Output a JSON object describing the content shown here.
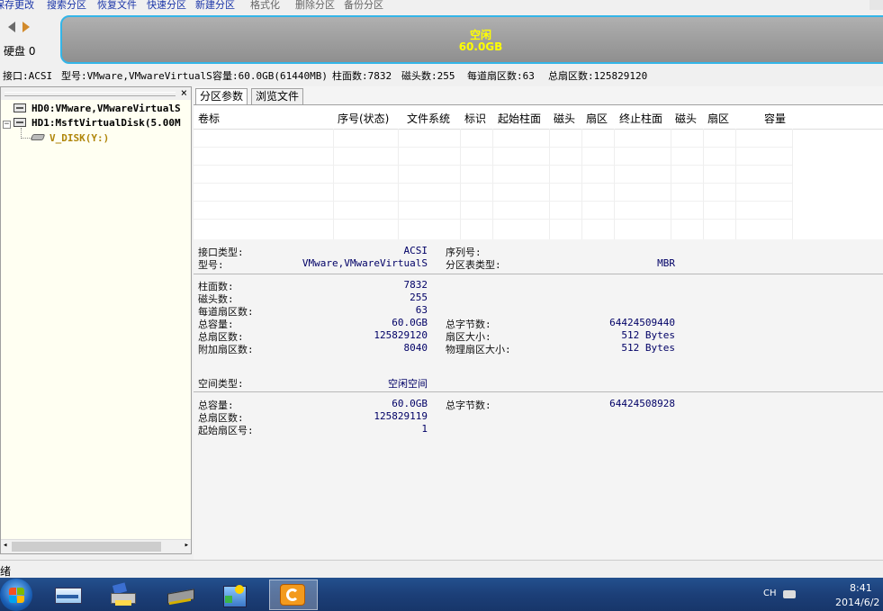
{
  "toolbar": {
    "items": [
      "保存更改",
      "搜索分区",
      "恢复文件",
      "快速分区",
      "新建分区",
      "格式化",
      "删除分区",
      "备份分区"
    ]
  },
  "diskbar": {
    "disk_label": "硬盘 0",
    "partition_label": "空闲",
    "partition_size": "60.0GB"
  },
  "infoline": {
    "interface": "接口:ACSI",
    "model": "型号:VMware,VMwareVirtualS",
    "capacity": "容量:60.0GB(61440MB)",
    "cylinders": "柱面数:7832",
    "heads": "磁头数:255",
    "sectors_per_track": "每道扇区数:63",
    "total_sectors": "总扇区数:125829120"
  },
  "tree": {
    "close": "×",
    "items": [
      {
        "label": "HD0:VMware,VMwareVirtualS"
      },
      {
        "label": "HD1:MsftVirtualDisk(5.00M"
      },
      {
        "label": "V_DISK(Y:)"
      }
    ]
  },
  "tabs": [
    "分区参数",
    "浏览文件"
  ],
  "table": {
    "columns": [
      "卷标",
      "序号(状态)",
      "文件系统",
      "标识",
      "起始柱面",
      "磁头",
      "扇区",
      "终止柱面",
      "磁头",
      "扇区",
      "容量"
    ]
  },
  "details": {
    "section1": {
      "interface_type_label": "接口类型:",
      "interface_type_value": "ACSI",
      "serial_label": "序列号:",
      "model_label": "型号:",
      "model_value": "VMware,VMwareVirtualS",
      "pt_type_label": "分区表类型:",
      "pt_type_value": "MBR"
    },
    "section2": {
      "cylinders_label": "柱面数:",
      "cylinders_value": "7832",
      "heads_label": "磁头数:",
      "heads_value": "255",
      "spt_label": "每道扇区数:",
      "spt_value": "63",
      "total_cap_label": "总容量:",
      "total_cap_value": "60.0GB",
      "total_bytes_label": "总字节数:",
      "total_bytes_value": "64424509440",
      "total_sectors_label": "总扇区数:",
      "total_sectors_value": "125829120",
      "sector_size_label": "扇区大小:",
      "sector_size_value": "512 Bytes",
      "extra_sectors_label": "附加扇区数:",
      "extra_sectors_value": "8040",
      "phys_sector_label": "物理扇区大小:",
      "phys_sector_value": "512 Bytes"
    },
    "section3": {
      "space_type_label": "空间类型:",
      "space_type_value": "空闲空间"
    },
    "section4": {
      "total_cap_label": "总容量:",
      "total_cap_value": "60.0GB",
      "total_bytes_label": "总字节数:",
      "total_bytes_value": "64424508928",
      "total_sectors_label": "总扇区数:",
      "total_sectors_value": "125829119",
      "start_sector_label": "起始扇区号:",
      "start_sector_value": "1"
    }
  },
  "status": {
    "text": "绪"
  },
  "taskbar": {
    "lang": "CH",
    "time": "8:41",
    "date": "2014/6/2"
  },
  "colors": {
    "partition_border": "#33b5e8",
    "partition_text": "#ffff00",
    "taskbar": "#1c3f78",
    "value_text": "#000066"
  }
}
